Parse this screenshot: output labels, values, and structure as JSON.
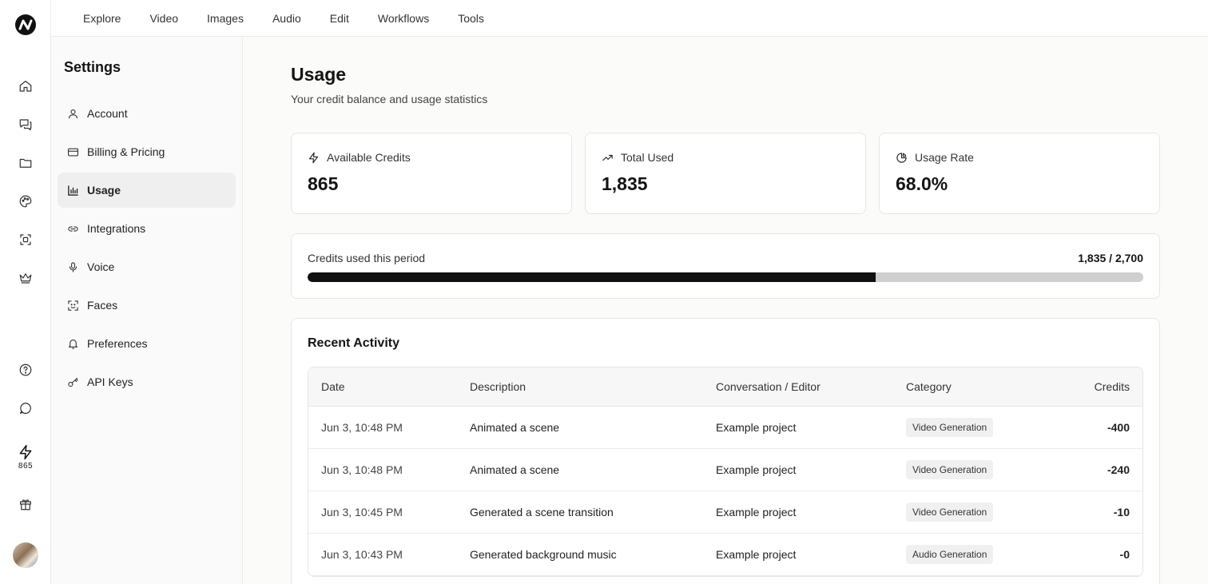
{
  "nav": {
    "items": [
      {
        "label": "Explore"
      },
      {
        "label": "Video"
      },
      {
        "label": "Images"
      },
      {
        "label": "Audio"
      },
      {
        "label": "Edit"
      },
      {
        "label": "Workflows"
      },
      {
        "label": "Tools"
      }
    ]
  },
  "rail": {
    "credits": "865"
  },
  "settings": {
    "title": "Settings",
    "items": [
      {
        "label": "Account",
        "icon": "user-icon"
      },
      {
        "label": "Billing & Pricing",
        "icon": "credit-card-icon"
      },
      {
        "label": "Usage",
        "icon": "bar-chart-icon",
        "active": true
      },
      {
        "label": "Integrations",
        "icon": "link-icon"
      },
      {
        "label": "Voice",
        "icon": "microphone-icon"
      },
      {
        "label": "Faces",
        "icon": "face-scan-icon"
      },
      {
        "label": "Preferences",
        "icon": "bell-icon"
      },
      {
        "label": "API Keys",
        "icon": "key-icon"
      }
    ]
  },
  "usage": {
    "title": "Usage",
    "subtitle": "Your credit balance and usage statistics",
    "stats": [
      {
        "label": "Available Credits",
        "value": "865",
        "icon": "lightning-icon"
      },
      {
        "label": "Total Used",
        "value": "1,835",
        "icon": "trending-up-icon"
      },
      {
        "label": "Usage Rate",
        "value": "68.0%",
        "icon": "pie-chart-icon"
      }
    ],
    "period": {
      "label": "Credits used this period",
      "summary": "1,835 / 2,700",
      "used": 1835,
      "total": 2700
    }
  },
  "activity": {
    "title": "Recent Activity",
    "columns": [
      "Date",
      "Description",
      "Conversation / Editor",
      "Category",
      "Credits"
    ],
    "rows": [
      {
        "date": "Jun 3, 10:48 PM",
        "description": "Animated a scene",
        "editor": "Example project",
        "category": "Video Generation",
        "credits": "-400"
      },
      {
        "date": "Jun 3, 10:48 PM",
        "description": "Animated a scene",
        "editor": "Example project",
        "category": "Video Generation",
        "credits": "-240"
      },
      {
        "date": "Jun 3, 10:45 PM",
        "description": "Generated a scene transition",
        "editor": "Example project",
        "category": "Video Generation",
        "credits": "-10"
      },
      {
        "date": "Jun 3, 10:43 PM",
        "description": "Generated background music",
        "editor": "Example project",
        "category": "Audio Generation",
        "credits": "-0"
      }
    ]
  }
}
